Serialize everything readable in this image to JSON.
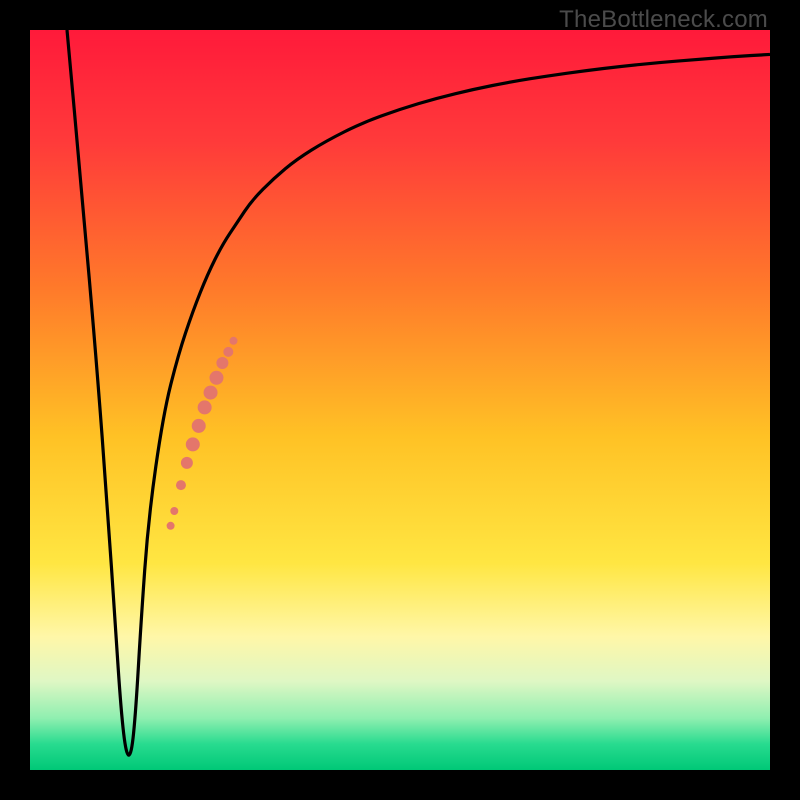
{
  "watermark": "TheBottleneck.com",
  "colors": {
    "frame": "#000000",
    "curve": "#000000",
    "dots": "#e4766b",
    "gradient_stops": [
      {
        "offset": 0.0,
        "color": "#ff1a3a"
      },
      {
        "offset": 0.15,
        "color": "#ff3a3a"
      },
      {
        "offset": 0.35,
        "color": "#ff7a2a"
      },
      {
        "offset": 0.55,
        "color": "#ffc225"
      },
      {
        "offset": 0.72,
        "color": "#ffe642"
      },
      {
        "offset": 0.82,
        "color": "#fff7a8"
      },
      {
        "offset": 0.88,
        "color": "#dff7c4"
      },
      {
        "offset": 0.93,
        "color": "#8fefb0"
      },
      {
        "offset": 0.965,
        "color": "#28db8f"
      },
      {
        "offset": 1.0,
        "color": "#00c877"
      }
    ]
  },
  "chart_data": {
    "type": "line",
    "title": "",
    "xlabel": "",
    "ylabel": "",
    "xlim": [
      0,
      100
    ],
    "ylim": [
      0,
      100
    ],
    "series": [
      {
        "name": "bottleneck-curve",
        "x": [
          5,
          7,
          9,
          10.5,
          11.5,
          12.3,
          13,
          13.7,
          14.3,
          15,
          16,
          18,
          20,
          22,
          24,
          26,
          28,
          30,
          33,
          36,
          40,
          45,
          50,
          55,
          60,
          65,
          70,
          75,
          80,
          85,
          90,
          95,
          100
        ],
        "y": [
          100,
          78,
          55,
          35,
          20,
          8,
          2,
          2,
          8,
          20,
          34,
          48,
          56,
          62,
          67,
          71,
          74,
          77,
          80,
          82.5,
          85,
          87.5,
          89.3,
          90.8,
          92,
          93,
          93.8,
          94.5,
          95.1,
          95.6,
          96,
          96.4,
          96.7
        ]
      }
    ],
    "scatter_overlay": {
      "name": "highlight-dots",
      "color": "#e4766b",
      "points": [
        {
          "x": 19.0,
          "y": 33.0,
          "r": 4
        },
        {
          "x": 19.5,
          "y": 35.0,
          "r": 4
        },
        {
          "x": 20.4,
          "y": 38.5,
          "r": 5
        },
        {
          "x": 21.2,
          "y": 41.5,
          "r": 6
        },
        {
          "x": 22.0,
          "y": 44.0,
          "r": 7
        },
        {
          "x": 22.8,
          "y": 46.5,
          "r": 7
        },
        {
          "x": 23.6,
          "y": 49.0,
          "r": 7
        },
        {
          "x": 24.4,
          "y": 51.0,
          "r": 7
        },
        {
          "x": 25.2,
          "y": 53.0,
          "r": 7
        },
        {
          "x": 26.0,
          "y": 55.0,
          "r": 6
        },
        {
          "x": 26.8,
          "y": 56.5,
          "r": 5
        },
        {
          "x": 27.5,
          "y": 58.0,
          "r": 4
        }
      ]
    }
  }
}
